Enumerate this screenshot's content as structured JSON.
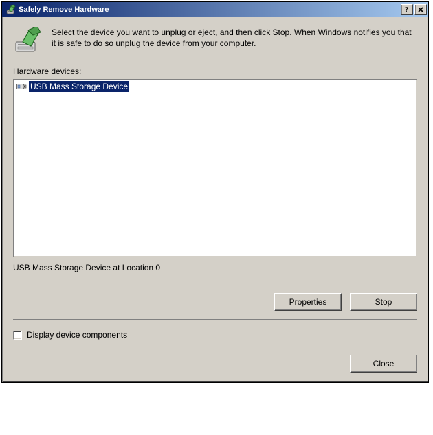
{
  "window": {
    "title": "Safely Remove Hardware"
  },
  "intro": "Select the device you want to unplug or eject, and then click Stop. When Windows notifies you that it is safe to do so unplug the device from your computer.",
  "list_label": "Hardware devices:",
  "devices": [
    {
      "name": "USB Mass Storage Device",
      "selected": true
    }
  ],
  "status": "USB Mass Storage Device at Location 0",
  "buttons": {
    "properties": "Properties",
    "stop": "Stop",
    "close": "Close"
  },
  "checkbox": {
    "display_components": "Display device components",
    "checked": false
  }
}
